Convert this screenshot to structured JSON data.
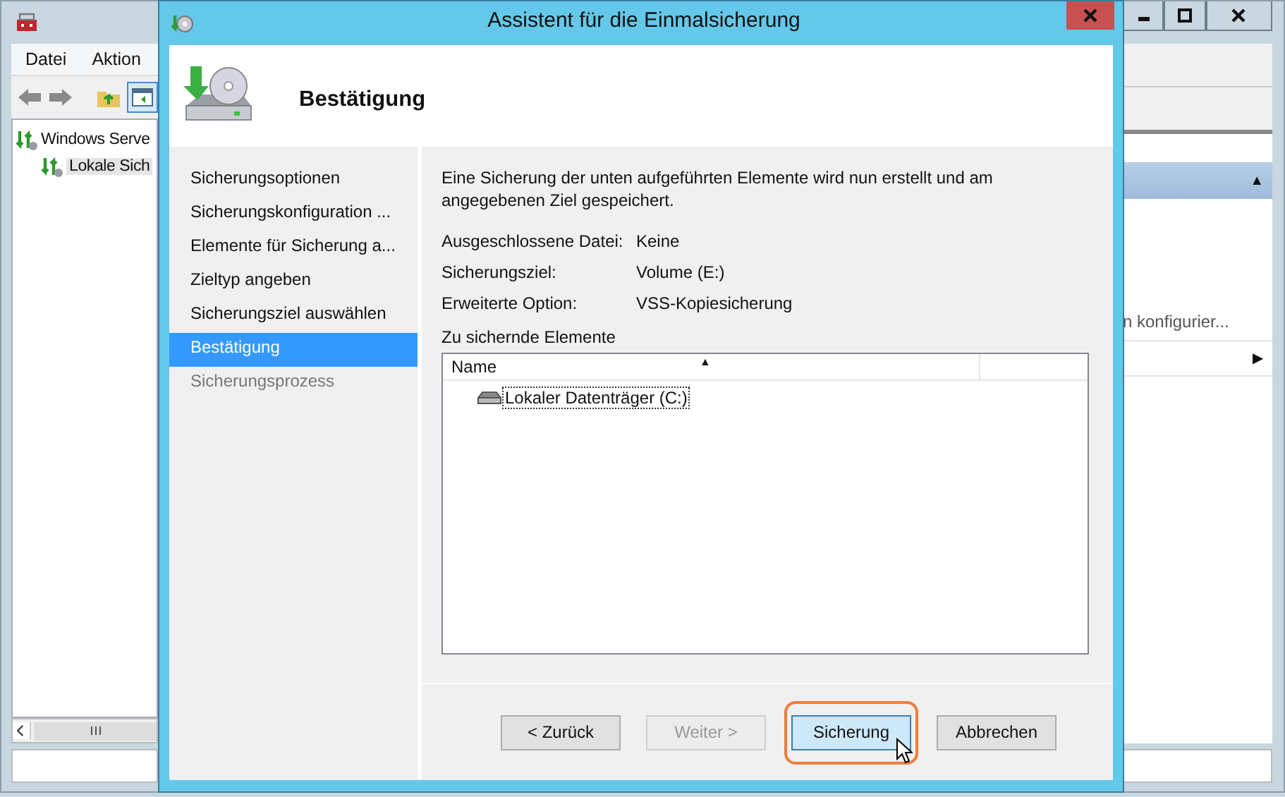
{
  "background_window": {
    "menu": [
      "Datei",
      "Aktion"
    ],
    "tree": [
      {
        "label": "Windows Serve",
        "children": [
          {
            "label": "Lokale Sich"
          }
        ]
      }
    ],
    "actions_panel": {
      "collapse_arrow": "▲",
      "item": "n konfigurier...",
      "submenu_arrow": "▶"
    }
  },
  "dialog": {
    "title": "Assistent für die Einmalsicherung",
    "page_title": "Bestätigung",
    "steps": [
      {
        "label": "Sicherungsoptionen",
        "selected": false,
        "disabled": false
      },
      {
        "label": "Sicherungskonfiguration ...",
        "selected": false,
        "disabled": false
      },
      {
        "label": "Elemente für Sicherung a...",
        "selected": false,
        "disabled": false
      },
      {
        "label": "Zieltyp angeben",
        "selected": false,
        "disabled": false
      },
      {
        "label": "Sicherungsziel auswählen",
        "selected": false,
        "disabled": false
      },
      {
        "label": "Bestätigung",
        "selected": true,
        "disabled": false
      },
      {
        "label": "Sicherungsprozess",
        "selected": false,
        "disabled": true
      }
    ],
    "intro": "Eine Sicherung der unten aufgeführten Elemente wird nun erstellt und am angegebenen Ziel gespeichert.",
    "details": [
      {
        "label": "Ausgeschlossene Datei:",
        "value": "Keine"
      },
      {
        "label": "Sicherungsziel:",
        "value": "Volume (E:)"
      },
      {
        "label": "Erweiterte Option:",
        "value": "VSS-Kopiesicherung"
      }
    ],
    "items_heading": "Zu sichernde Elemente",
    "list": {
      "columns": [
        {
          "label": "Name",
          "sort_indicator": "▲"
        }
      ],
      "rows": [
        {
          "label": "Lokaler Datenträger (C:)",
          "focused": true
        }
      ]
    },
    "buttons": [
      {
        "label": "< Zurück",
        "disabled": false,
        "highlighted": false
      },
      {
        "label": "Weiter >",
        "disabled": true,
        "highlighted": false
      },
      {
        "label": "Sicherung",
        "disabled": false,
        "highlighted": true
      },
      {
        "label": "Abbrechen",
        "disabled": false,
        "highlighted": false
      }
    ]
  }
}
